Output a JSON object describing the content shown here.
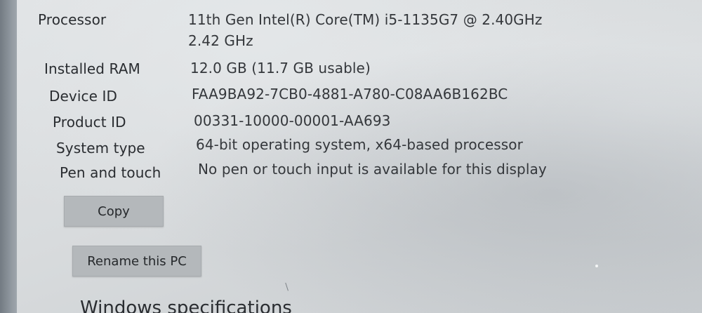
{
  "device_specifications": {
    "rows": [
      {
        "label": "Processor",
        "value": "11th Gen Intel(R) Core(TM) i5-1135G7 @ 2.40GHz",
        "value_line2": "2.42 GHz"
      },
      {
        "label": "Installed RAM",
        "value": "12.0 GB (11.7 GB usable)"
      },
      {
        "label": "Device ID",
        "value": "FAA9BA92-7CB0-4881-A780-C08AA6B162BC"
      },
      {
        "label": "Product ID",
        "value": "00331-10000-00001-AA693"
      },
      {
        "label": "System type",
        "value": "64-bit operating system, x64-based processor"
      },
      {
        "label": "Pen and touch",
        "value": "No pen or touch input is available for this display"
      }
    ],
    "copy_button": "Copy",
    "rename_button": "Rename this PC"
  },
  "windows_specifications": {
    "heading": "Windows specifications"
  },
  "colors": {
    "background": "#d8dbdd",
    "text": "#2f3236",
    "button_background": "#b4b8bb"
  }
}
